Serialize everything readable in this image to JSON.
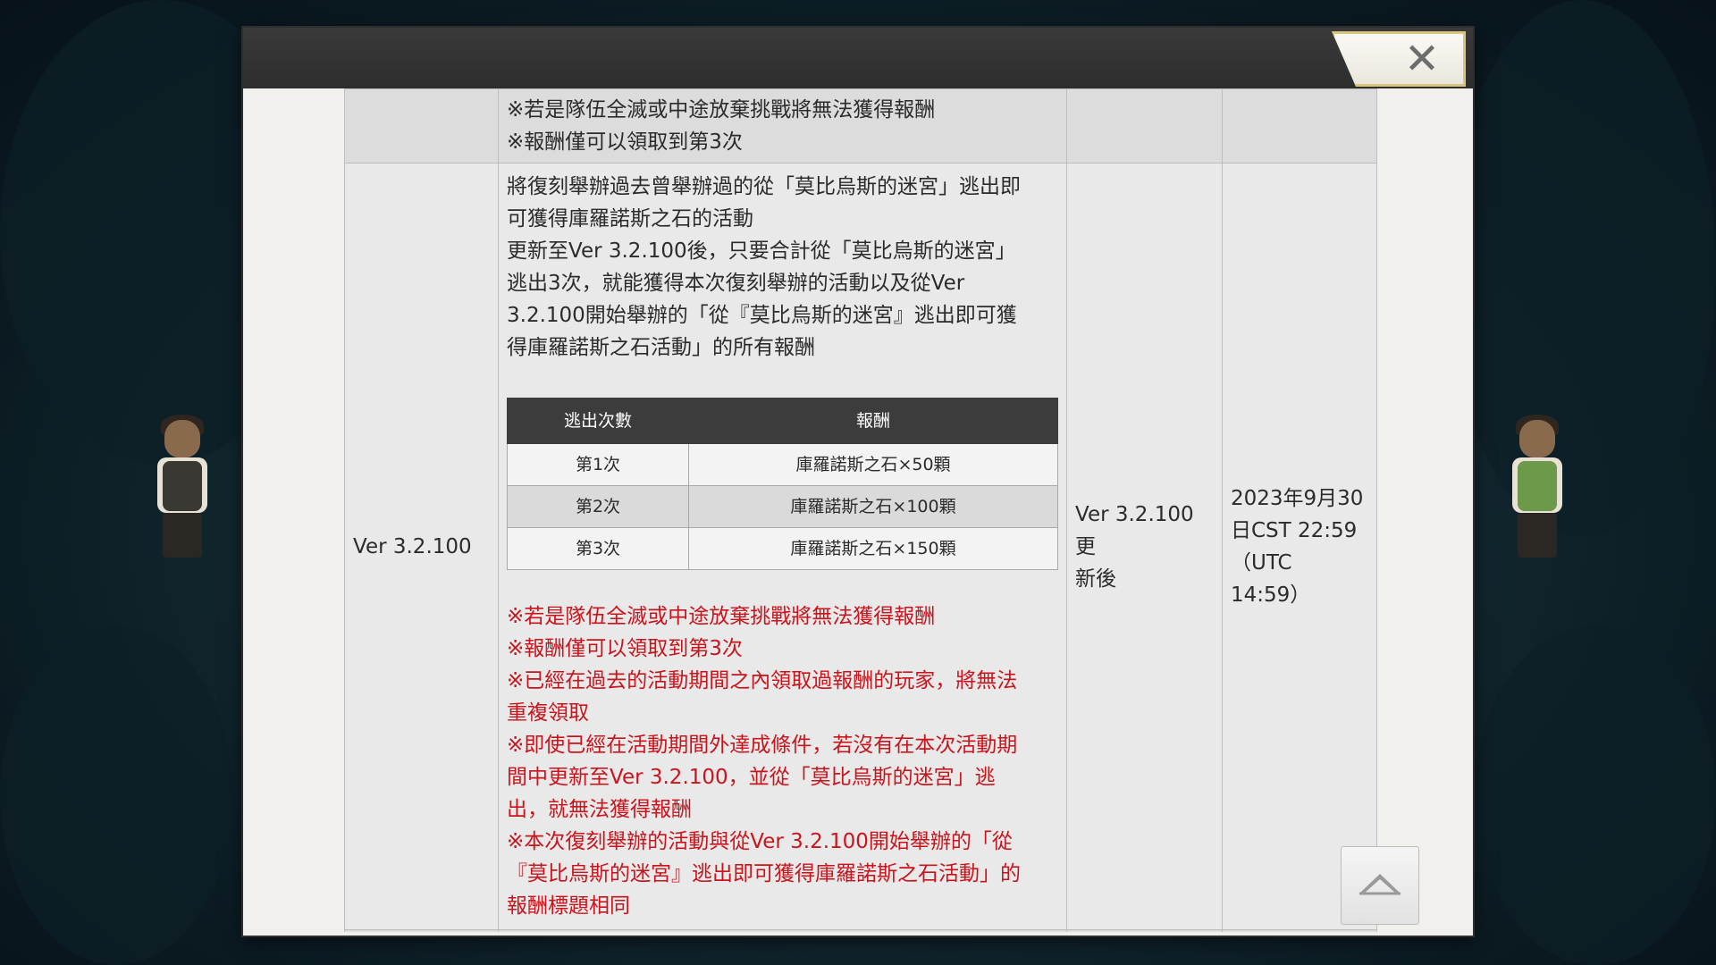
{
  "dialog": {
    "close_icon": "close-icon",
    "scroll_top_icon": "chevron-up-icon"
  },
  "table": {
    "prev_row": {
      "notes": [
        "※若是隊伍全滅或中途放棄挑戰將無法獲得報酬",
        "※報酬僅可以領取到第3次"
      ]
    },
    "row": {
      "version": "Ver 3.2.100",
      "description": [
        "將復刻舉辦過去曾舉辦過的從「莫比烏斯的迷宮」逃出即",
        "可獲得庫羅諾斯之石的活動",
        "更新至Ver 3.2.100後，只要合計從「莫比烏斯的迷宮」",
        "逃出3次，就能獲得本次復刻舉辦的活動以及從Ver",
        "3.2.100開始舉辦的「從『莫比烏斯的迷宮』逃出即可獲",
        "得庫羅諾斯之石活動」的所有報酬"
      ],
      "reward_table": {
        "headers": [
          "逃出次數",
          "報酬"
        ],
        "rows": [
          [
            "第1次",
            "庫羅諾斯之石×50顆"
          ],
          [
            "第2次",
            "庫羅諾斯之石×100顆"
          ],
          [
            "第3次",
            "庫羅諾斯之石×150顆"
          ]
        ]
      },
      "notes": [
        "※若是隊伍全滅或中途放棄挑戰將無法獲得報酬",
        "※報酬僅可以領取到第3次",
        "※已經在過去的活動期間之內領取過報酬的玩家，將無法",
        "重複領取",
        "※即使已經在活動期間外達成條件，若沒有在本次活動期",
        "間中更新至Ver 3.2.100，並從「莫比烏斯的迷宮」逃",
        "出，就無法獲得報酬",
        "※本次復刻舉辦的活動與從Ver 3.2.100開始舉辦的「從",
        "『莫比烏斯的迷宮』逃出即可獲得庫羅諾斯之石活動」的",
        "報酬標題相同"
      ],
      "start": [
        "Ver 3.2.100更",
        "新後"
      ],
      "end": [
        "2023年9月30",
        "日CST 22:59",
        "（UTC",
        "14:59）"
      ]
    }
  }
}
